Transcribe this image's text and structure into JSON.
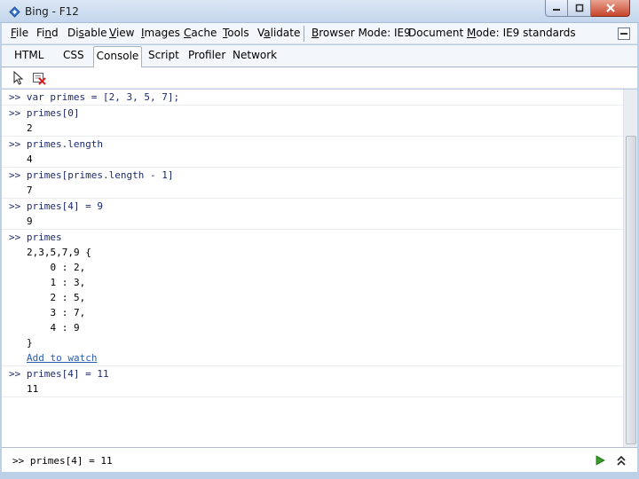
{
  "window": {
    "title": "Bing - F12"
  },
  "menu": {
    "items": [
      {
        "pre": "",
        "acc": "F",
        "post": "ile"
      },
      {
        "pre": "Fi",
        "acc": "n",
        "post": "d"
      },
      {
        "pre": "Di",
        "acc": "s",
        "post": "able"
      },
      {
        "pre": "",
        "acc": "V",
        "post": "iew"
      },
      {
        "pre": "",
        "acc": "I",
        "post": "mages"
      },
      {
        "pre": "",
        "acc": "C",
        "post": "ache"
      },
      {
        "pre": "",
        "acc": "T",
        "post": "ools"
      },
      {
        "pre": "V",
        "acc": "a",
        "post": "lidate"
      }
    ],
    "browser_mode": {
      "pre": "",
      "acc": "B",
      "post": "rowser Mode:",
      "value": "IE9"
    },
    "document_mode": {
      "pre": "Document ",
      "acc": "M",
      "post": "ode:",
      "value": "IE9 standards"
    }
  },
  "tabs": [
    "HTML",
    "CSS",
    "Console",
    "Script",
    "Profiler",
    "Network"
  ],
  "console": {
    "prompt": ">>",
    "entries": [
      {
        "cmd": "var primes = [2, 3, 5, 7];",
        "out": []
      },
      {
        "cmd": "primes[0]",
        "out": [
          "2"
        ]
      },
      {
        "cmd": "primes.length",
        "out": [
          "4"
        ]
      },
      {
        "cmd": "primes[primes.length - 1]",
        "out": [
          "7"
        ]
      },
      {
        "cmd": "primes[4] = 9",
        "out": [
          "9"
        ]
      },
      {
        "cmd": "primes",
        "out": [
          "2,3,5,7,9 {",
          "    0 : 2,",
          "    1 : 3,",
          "    2 : 5,",
          "    3 : 7,",
          "    4 : 9",
          "}"
        ],
        "link": "Add to watch"
      },
      {
        "cmd": "primes[4] = 11",
        "out": [
          "11"
        ]
      }
    ]
  },
  "input": {
    "value": ">> primes[4] = 11"
  },
  "colors": {
    "titlebar": "#c4d6ec",
    "command_text": "#1b2a6e",
    "link": "#2a5db0",
    "run_green": "#3a9a2a"
  }
}
